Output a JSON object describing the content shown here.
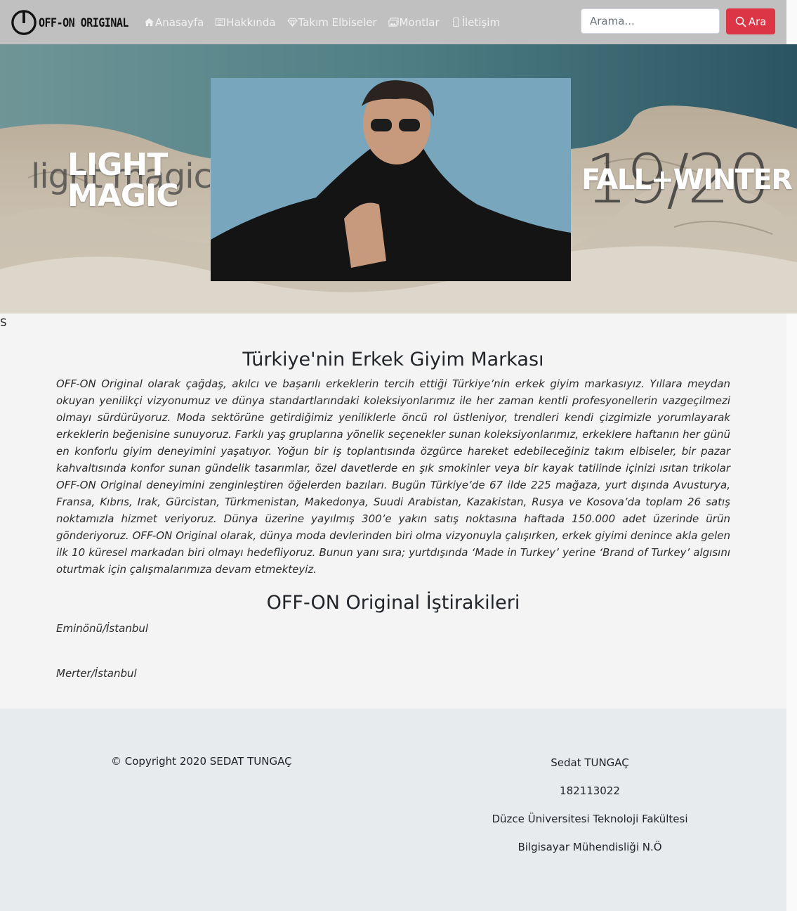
{
  "brand": {
    "name": "OFF-ON ORIGINAL"
  },
  "nav": {
    "items": [
      {
        "label": "Anasayfa",
        "icon": "home-icon"
      },
      {
        "label": "Hakkında",
        "icon": "newspaper-icon"
      },
      {
        "label": "Takım Elbiseler",
        "icon": "gem-icon"
      },
      {
        "label": "Montlar",
        "icon": "images-icon"
      },
      {
        "label": "İletişim",
        "icon": "phone-icon"
      }
    ]
  },
  "search": {
    "placeholder": "Arama...",
    "button_label": "Ara",
    "button_color": "#dc3545"
  },
  "hero": {
    "left_ghost": "light magic",
    "left_line1": "LIGHT",
    "left_line2": "MAGIC",
    "right_ghost": "19/20",
    "right_text": "FALL+WINTER"
  },
  "stray_text": "S",
  "main": {
    "title": "Türkiye'nin Erkek Giyim Markası",
    "about": "OFF-ON Original olarak çağdaş, akılcı ve başarılı erkeklerin tercih ettiği Türkiye’nin erkek giyim markasıyız. Yıllara meydan okuyan yenilikçi vizyonumuz ve dünya standartlarındaki koleksiyonlarımız ile her zaman kentli profesyonellerin vazgeçilmezi olmayı sürdürüyoruz. Moda sektörüne getirdiğimiz yeniliklerle öncü rol üstleniyor, trendleri kendi çizgimizle yorumlayarak erkeklerin beğenisine sunuyoruz. Farklı yaş gruplarına yönelik seçenekler sunan koleksiyonlarımız, erkeklere haftanın her günü en konforlu giyim deneyimini yaşatıyor. Yoğun bir iş toplantısında özgürce hareket edebileceğiniz takım elbiseler, bir pazar kahvaltısında konfor sunan gündelik tasarımlar, özel davetlerde en şık smokinler veya bir kayak tatilinde içinizi ısıtan trikolar OFF-ON Original deneyimini zenginleştiren öğelerden bazıları. Bugün Türkiye’de 67 ilde 225 mağaza, yurt dışında Avusturya, Fransa, Kıbrıs, Irak, Gürcistan, Türkmenistan, Makedonya, Suudi Arabistan, Kazakistan, Rusya ve Kosova’da toplam 26 satış noktamızla hizmet veriyoruz. Dünya üzerine yayılmış 300’e yakın satış noktasına haftada 150.000 adet üzerinde ürün gönderiyoruz. OFF-ON Original olarak, dünya moda devlerinden biri olma vizyonuyla çalışırken, erkek giyimi denince akla gelen ilk 10 küresel markadan biri olmayı hedefliyoruz. Bunun yanı sıra; yurtdışında ‘Made in Turkey’ yerine ‘Brand of Turkey’ algısını oturtmak için çalışmalarımıza devam etmekteyiz.",
    "subsidiaries_title": "OFF-ON Original İştirakileri",
    "subsidiaries": [
      "Eminönü/İstanbul",
      "Merter/İstanbul"
    ]
  },
  "footer": {
    "copyright": "© Copyright 2020 SEDAT TUNGAÇ",
    "contact": [
      "Sedat TUNGAÇ",
      "182113022",
      "Düzce Üniversitesi Teknoloji Fakültesi",
      "Bilgisayar Mühendisliği N.Ö"
    ]
  }
}
